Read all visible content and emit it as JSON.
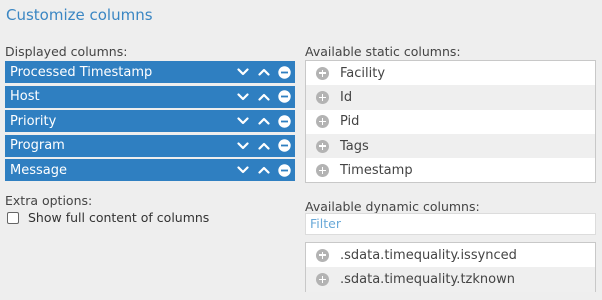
{
  "title": "Customize columns",
  "displayed": {
    "label": "Displayed columns:",
    "items": [
      {
        "label": "Processed Timestamp"
      },
      {
        "label": "Host"
      },
      {
        "label": "Priority"
      },
      {
        "label": "Program"
      },
      {
        "label": "Message"
      }
    ]
  },
  "extra": {
    "label": "Extra options:",
    "show_full_label": "Show full content of columns",
    "show_full_checked": false
  },
  "static_columns": {
    "label": "Available static columns:",
    "items": [
      {
        "label": "Facility"
      },
      {
        "label": "Id"
      },
      {
        "label": "Pid"
      },
      {
        "label": "Tags"
      },
      {
        "label": "Timestamp"
      }
    ]
  },
  "dynamic_columns": {
    "label": "Available dynamic columns:",
    "filter_placeholder": "Filter",
    "items": [
      {
        "label": ".sdata.timequality.issynced"
      },
      {
        "label": ".sdata.timequality.tzknown"
      }
    ]
  },
  "colors": {
    "accent": "#2f7fc1",
    "title": "#3a86c3",
    "add_icon": "#b3b3b3"
  }
}
